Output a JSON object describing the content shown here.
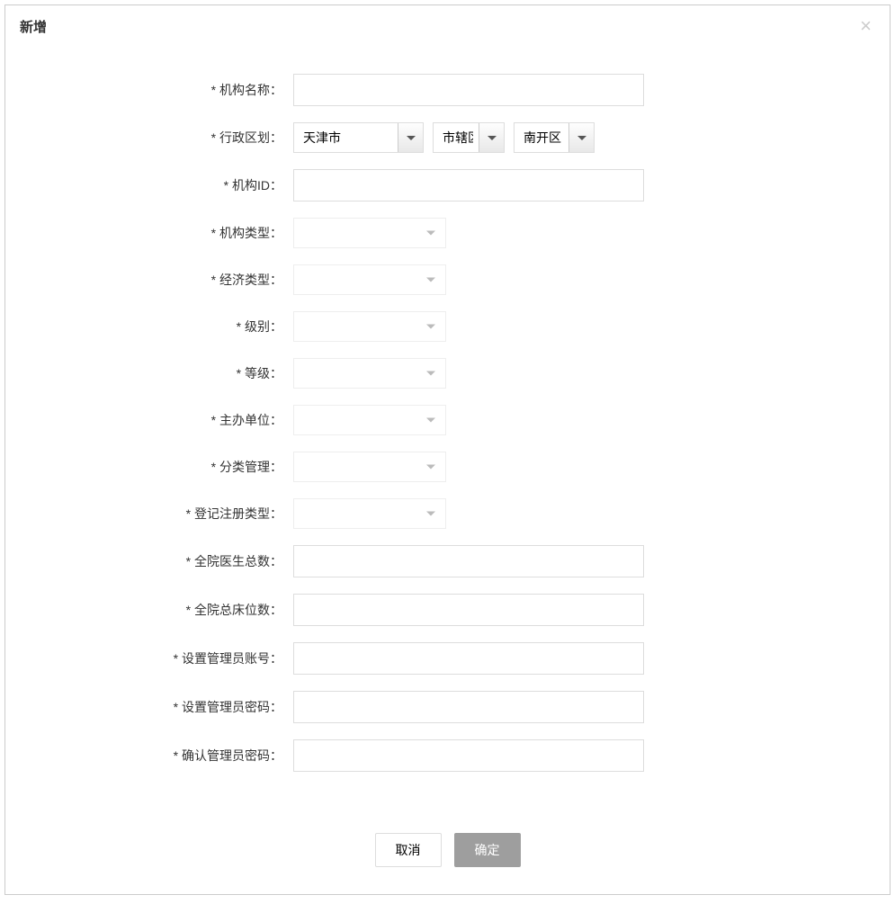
{
  "modal": {
    "title": "新增",
    "close": "×"
  },
  "form": {
    "org_name": {
      "label": "机构名称：",
      "value": ""
    },
    "region": {
      "label": "行政区划：",
      "province": "天津市",
      "city": "市辖区",
      "district": "南开区"
    },
    "org_id": {
      "label": "机构ID：",
      "value": ""
    },
    "org_type": {
      "label": "机构类型：",
      "value": ""
    },
    "econ_type": {
      "label": "经济类型：",
      "value": ""
    },
    "level": {
      "label": "级别：",
      "value": ""
    },
    "grade": {
      "label": "等级：",
      "value": ""
    },
    "host_unit": {
      "label": "主办单位：",
      "value": ""
    },
    "classify_mgmt": {
      "label": "分类管理：",
      "value": ""
    },
    "reg_type": {
      "label": "登记注册类型：",
      "value": ""
    },
    "doctor_total": {
      "label": "全院医生总数：",
      "value": ""
    },
    "bed_total": {
      "label": "全院总床位数：",
      "value": ""
    },
    "admin_account": {
      "label": "设置管理员账号：",
      "value": ""
    },
    "admin_pwd": {
      "label": "设置管理员密码：",
      "value": ""
    },
    "admin_pwd_confirm": {
      "label": "确认管理员密码：",
      "value": ""
    }
  },
  "footer": {
    "cancel": "取消",
    "confirm": "确定"
  }
}
